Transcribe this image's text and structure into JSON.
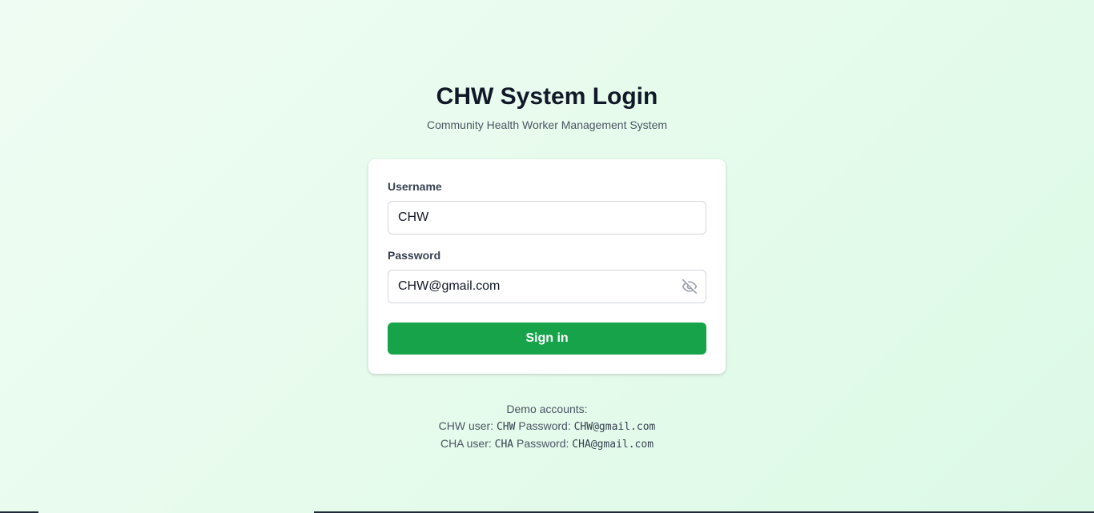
{
  "header": {
    "title": "CHW System Login",
    "subtitle": "Community Health Worker Management System"
  },
  "form": {
    "username_label": "Username",
    "username_value": "CHW",
    "password_label": "Password",
    "password_value": "CHW@gmail.com",
    "password_toggle_icon": "eye-off-icon",
    "submit_label": "Sign in"
  },
  "demo": {
    "heading": "Demo accounts:",
    "accounts": [
      {
        "role_label": "CHW user:",
        "username": "CHW",
        "password_label": "Password:",
        "password": "CHW@gmail.com"
      },
      {
        "role_label": "CHA user:",
        "username": "CHA",
        "password_label": "Password:",
        "password": "CHA@gmail.com"
      }
    ]
  },
  "colors": {
    "accent": "#16a34a",
    "background": "#e6fbec",
    "title": "#111827",
    "muted": "#4b5563"
  }
}
